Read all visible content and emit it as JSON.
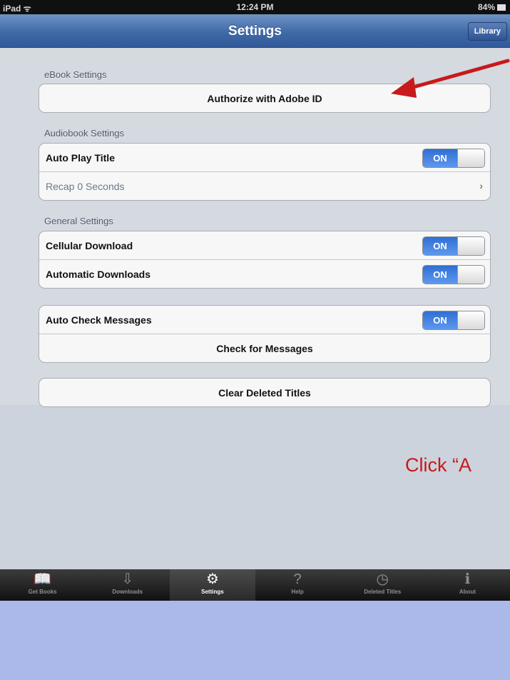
{
  "status_bar": {
    "device": "iPad ᯤ",
    "time": "12:24 PM",
    "battery": "84%"
  },
  "nav": {
    "title": "Settings",
    "library_label": "Library"
  },
  "sections": {
    "ebook": {
      "header": "eBook Settings",
      "authorize_label": "Authorize with Adobe ID"
    },
    "audiobook": {
      "header": "Audiobook Settings",
      "auto_play_label": "Auto Play Title",
      "auto_play_toggle": "ON",
      "recap_label": "Recap 0 Seconds"
    },
    "general": {
      "header": "General Settings",
      "cellular_label": "Cellular Download",
      "cellular_toggle": "ON",
      "auto_downloads_label": "Automatic Downloads",
      "auto_downloads_toggle": "ON"
    },
    "messages": {
      "auto_check_label": "Auto Check Messages",
      "auto_check_toggle": "ON",
      "check_label": "Check for Messages"
    },
    "clear": {
      "clear_label": "Clear Deleted Titles"
    }
  },
  "tabs": [
    {
      "label": "Get Books",
      "icon": "book-icon",
      "glyph": "📖"
    },
    {
      "label": "Downloads",
      "icon": "download-icon",
      "glyph": "⇩"
    },
    {
      "label": "Settings",
      "icon": "gear-icon",
      "glyph": "⚙"
    },
    {
      "label": "Help",
      "icon": "question-icon",
      "glyph": "?"
    },
    {
      "label": "Deleted Titles",
      "icon": "clock-icon",
      "glyph": "◷"
    },
    {
      "label": "About",
      "icon": "info-icon",
      "glyph": "ℹ"
    }
  ],
  "annotation": {
    "text": "Click “A",
    "color": "#c8191b"
  },
  "colors": {
    "nav_blue": "#3f6aa6",
    "toggle_on": "#2f6fd3",
    "slide_bg": "#aab8ea"
  }
}
